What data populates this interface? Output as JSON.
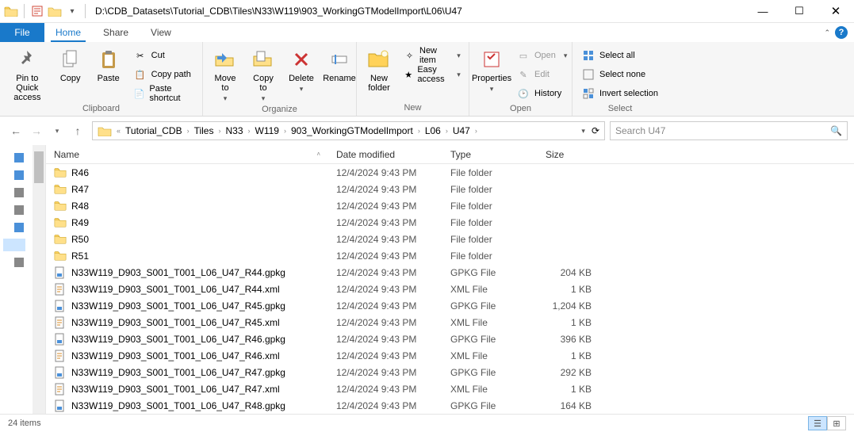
{
  "title_path": "D:\\CDB_Datasets\\Tutorial_CDB\\Tiles\\N33\\W119\\903_WorkingGTModelImport\\L06\\U47",
  "tabs": {
    "file": "File",
    "home": "Home",
    "share": "Share",
    "view": "View"
  },
  "ribbon": {
    "clipboard": {
      "pin": "Pin to Quick\naccess",
      "copy": "Copy",
      "paste": "Paste",
      "cut": "Cut",
      "copypath": "Copy path",
      "pasteshort": "Paste shortcut",
      "label": "Clipboard"
    },
    "organize": {
      "moveto": "Move\nto",
      "copyto": "Copy\nto",
      "delete": "Delete",
      "rename": "Rename",
      "label": "Organize"
    },
    "new": {
      "newfolder": "New\nfolder",
      "newitem": "New item",
      "easy": "Easy access",
      "label": "New"
    },
    "open": {
      "properties": "Properties",
      "open": "Open",
      "edit": "Edit",
      "history": "History",
      "label": "Open"
    },
    "select": {
      "all": "Select all",
      "none": "Select none",
      "invert": "Invert selection",
      "label": "Select"
    }
  },
  "breadcrumbs": [
    "Tutorial_CDB",
    "Tiles",
    "N33",
    "W119",
    "903_WorkingGTModelImport",
    "L06",
    "U47"
  ],
  "search_placeholder": "Search U47",
  "columns": {
    "name": "Name",
    "date": "Date modified",
    "type": "Type",
    "size": "Size"
  },
  "rows": [
    {
      "icon": "folder",
      "name": "R46",
      "date": "12/4/2024 9:43 PM",
      "type": "File folder",
      "size": ""
    },
    {
      "icon": "folder",
      "name": "R47",
      "date": "12/4/2024 9:43 PM",
      "type": "File folder",
      "size": ""
    },
    {
      "icon": "folder",
      "name": "R48",
      "date": "12/4/2024 9:43 PM",
      "type": "File folder",
      "size": ""
    },
    {
      "icon": "folder",
      "name": "R49",
      "date": "12/4/2024 9:43 PM",
      "type": "File folder",
      "size": ""
    },
    {
      "icon": "folder",
      "name": "R50",
      "date": "12/4/2024 9:43 PM",
      "type": "File folder",
      "size": ""
    },
    {
      "icon": "folder",
      "name": "R51",
      "date": "12/4/2024 9:43 PM",
      "type": "File folder",
      "size": ""
    },
    {
      "icon": "gpkg",
      "name": "N33W119_D903_S001_T001_L06_U47_R44.gpkg",
      "date": "12/4/2024 9:43 PM",
      "type": "GPKG File",
      "size": "204 KB"
    },
    {
      "icon": "xml",
      "name": "N33W119_D903_S001_T001_L06_U47_R44.xml",
      "date": "12/4/2024 9:43 PM",
      "type": "XML File",
      "size": "1 KB"
    },
    {
      "icon": "gpkg",
      "name": "N33W119_D903_S001_T001_L06_U47_R45.gpkg",
      "date": "12/4/2024 9:43 PM",
      "type": "GPKG File",
      "size": "1,204 KB"
    },
    {
      "icon": "xml",
      "name": "N33W119_D903_S001_T001_L06_U47_R45.xml",
      "date": "12/4/2024 9:43 PM",
      "type": "XML File",
      "size": "1 KB"
    },
    {
      "icon": "gpkg",
      "name": "N33W119_D903_S001_T001_L06_U47_R46.gpkg",
      "date": "12/4/2024 9:43 PM",
      "type": "GPKG File",
      "size": "396 KB"
    },
    {
      "icon": "xml",
      "name": "N33W119_D903_S001_T001_L06_U47_R46.xml",
      "date": "12/4/2024 9:43 PM",
      "type": "XML File",
      "size": "1 KB"
    },
    {
      "icon": "gpkg",
      "name": "N33W119_D903_S001_T001_L06_U47_R47.gpkg",
      "date": "12/4/2024 9:43 PM",
      "type": "GPKG File",
      "size": "292 KB"
    },
    {
      "icon": "xml",
      "name": "N33W119_D903_S001_T001_L06_U47_R47.xml",
      "date": "12/4/2024 9:43 PM",
      "type": "XML File",
      "size": "1 KB"
    },
    {
      "icon": "gpkg",
      "name": "N33W119_D903_S001_T001_L06_U47_R48.gpkg",
      "date": "12/4/2024 9:43 PM",
      "type": "GPKG File",
      "size": "164 KB"
    }
  ],
  "status": "24 items"
}
